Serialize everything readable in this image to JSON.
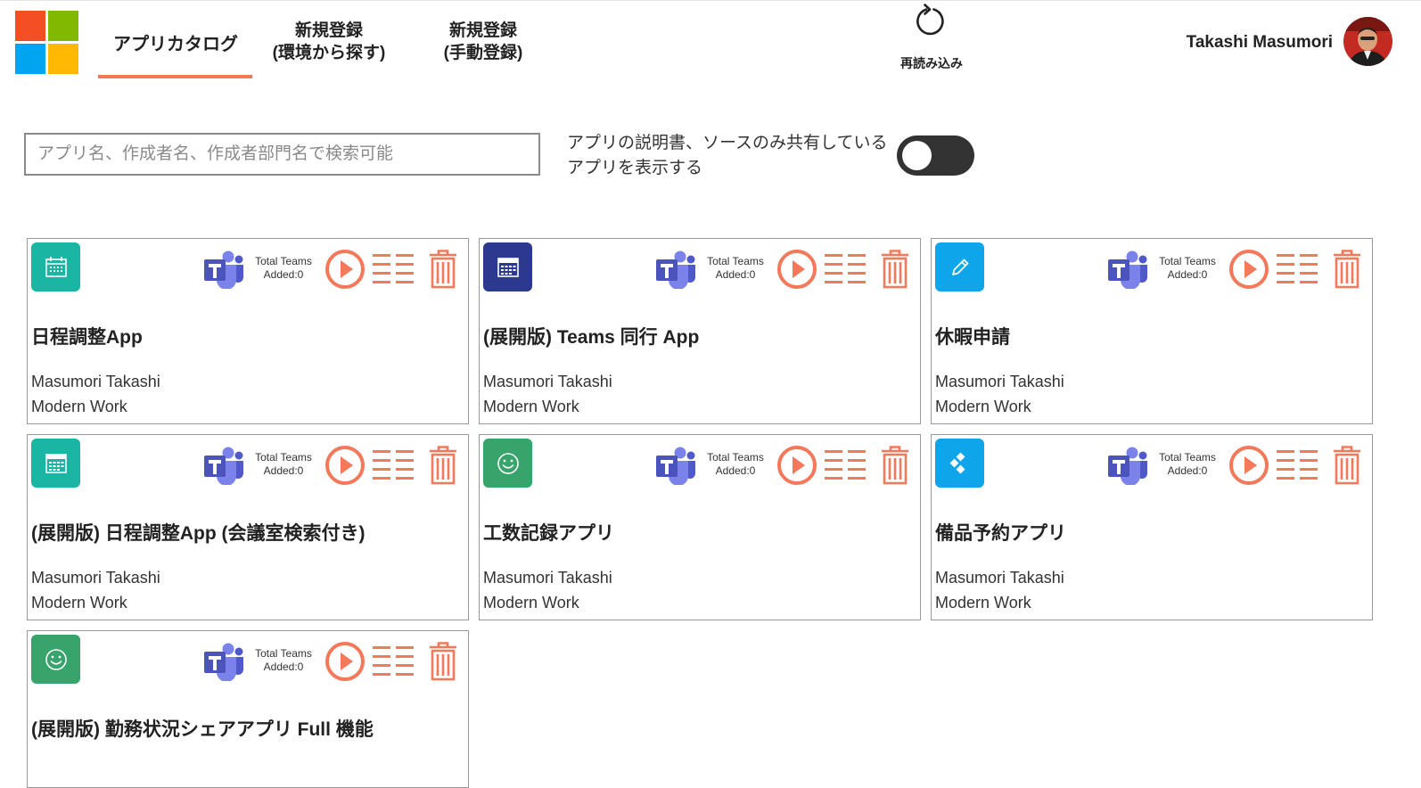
{
  "header": {
    "logo": "microsoft-logo",
    "tabs": [
      {
        "label": "アプリカタログ"
      },
      {
        "line1": "新規登録",
        "line2": "(環境から探す)"
      },
      {
        "line1": "新規登録",
        "line2": "(手動登録)"
      }
    ],
    "reload_label": "再読み込み",
    "user_name": "Takashi Masumori"
  },
  "search": {
    "placeholder": "アプリ名、作成者名、作成者部門名で検索可能",
    "value": ""
  },
  "toggle": {
    "label": "アプリの説明書、ソースのみ共有しているアプリを表示する",
    "on": false
  },
  "colors": {
    "accent": "#f4785a",
    "teams_purple": "#5558af",
    "teal": "#19b7a3",
    "navy": "#2b3a8f",
    "blue": "#0fa5ea",
    "green": "#36a46b"
  },
  "apps": [
    {
      "title": "日程調整App",
      "author": "Masumori Takashi",
      "dept": "Modern Work",
      "icon": "calendar-icon",
      "icon_color": "#19b7a3",
      "teams_label": "Total Teams",
      "teams_added": "Added:0"
    },
    {
      "title": "(展開版) Teams 同行 App",
      "author": "Masumori Takashi",
      "dept": "Modern Work",
      "icon": "calendar-grid-icon",
      "icon_color": "#2b3a8f",
      "teams_label": "Total Teams",
      "teams_added": "Added:0"
    },
    {
      "title": "休暇申請",
      "author": "Masumori Takashi",
      "dept": "Modern Work",
      "icon": "pencil-icon",
      "icon_color": "#0fa5ea",
      "teams_label": "Total Teams",
      "teams_added": "Added:0"
    },
    {
      "title": "(展開版) 日程調整App (会議室検索付き)",
      "author": "Masumori Takashi",
      "dept": "Modern Work",
      "icon": "calendar-grid-icon",
      "icon_color": "#19b7a3",
      "teams_label": "Total Teams",
      "teams_added": "Added:0"
    },
    {
      "title": "工数記録アプリ",
      "author": "Masumori Takashi",
      "dept": "Modern Work",
      "icon": "smiley-icon",
      "icon_color": "#36a46b",
      "teams_label": "Total Teams",
      "teams_added": "Added:0"
    },
    {
      "title": "備品予約アプリ",
      "author": "Masumori Takashi",
      "dept": "Modern Work",
      "icon": "diamond-dots-icon",
      "icon_color": "#0fa5ea",
      "teams_label": "Total Teams",
      "teams_added": "Added:0"
    },
    {
      "title": "(展開版) 勤務状況シェアアプリ Full 機能",
      "author": "",
      "dept": "",
      "icon": "smiley-icon",
      "icon_color": "#36a46b",
      "teams_label": "Total Teams",
      "teams_added": "Added:0"
    }
  ]
}
